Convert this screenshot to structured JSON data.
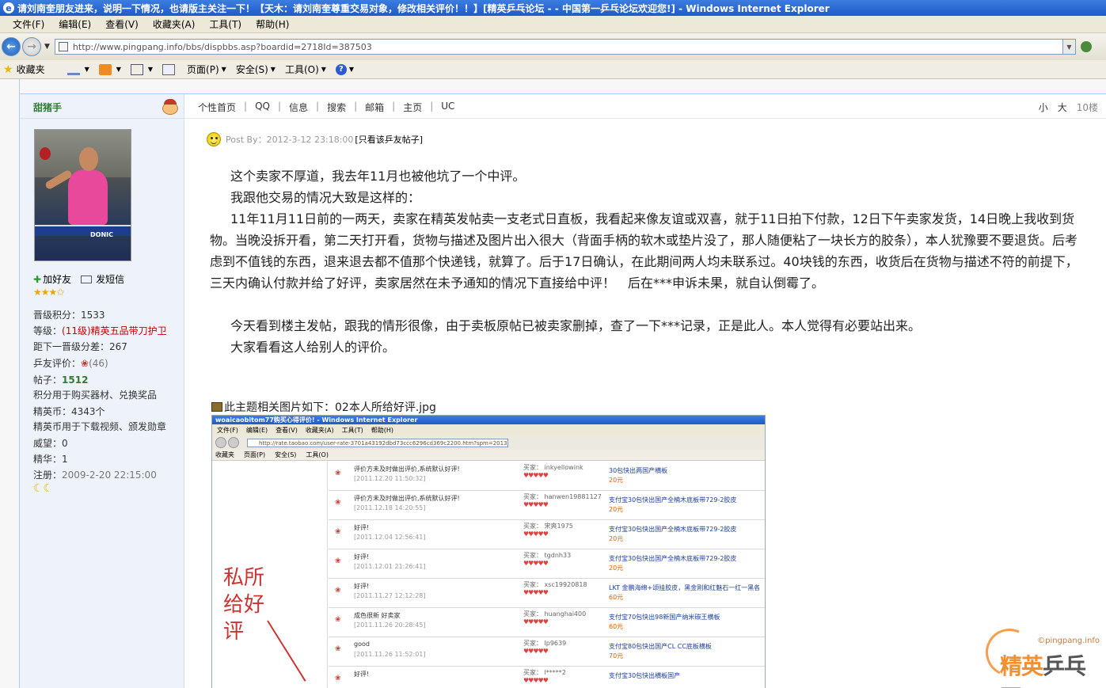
{
  "window": {
    "title": "请刘南奎朋友进来，说明一下情况，也请版主关注一下！【天木：请刘南奎尊重交易对象，修改相关评价！！】[精英乒乓论坛 - - 中国第一乒乓论坛欢迎您!] - Windows Internet Explorer",
    "icon": "e"
  },
  "menubar": [
    "文件(F)",
    "编辑(E)",
    "查看(V)",
    "收藏夹(A)",
    "工具(T)",
    "帮助(H)"
  ],
  "address": {
    "url": "http://www.pingpang.info/bbs/dispbbs.asp?boardid=2718Id=387503"
  },
  "commandbar": {
    "favorites": "收藏夹",
    "page": "页面(P)",
    "safety": "安全(S)",
    "tools": "工具(O)",
    "help": "?"
  },
  "user": {
    "name": "甜猪手",
    "add_friend": "加好友",
    "send_message": "发短信",
    "stars": "★★★✩",
    "level_points_label": "晋级积分：",
    "level_points": "1533",
    "grade_label": "等级：",
    "grade_value": "(11级)精英五品带刀护卫",
    "next_label": "距下一晋级分差：",
    "next_value": "267",
    "rating_label": "乒友评价：",
    "rating_value": "(46)",
    "posts_label": "帖子：",
    "posts_value": "1512",
    "points_note": "积分用于购买器材、兑换奖品",
    "coins_label": "精英币：",
    "coins_value": "4343个",
    "coins_note": "精英币用于下载视频、颁发勋章",
    "prestige_label": "威望：",
    "prestige_value": "0",
    "essence_label": "精华：",
    "essence_value": "1",
    "register_label": "注册：",
    "register_value": "2009-2-20 22:15:00"
  },
  "postnav": [
    "个性首页",
    "QQ",
    "信息",
    "搜索",
    "邮箱",
    "主页",
    "UC"
  ],
  "sizectl": {
    "small": "小",
    "large": "大",
    "floor": "10楼"
  },
  "post": {
    "by_label": "Post By：2012-3-12 23:18:00",
    "only_link": "[只看该乒友帖子]",
    "paragraphs": [
      "这个卖家不厚道，我去年11月也被他坑了一个中评。",
      "我跟他交易的情况大致是这样的：",
      "11年11月11日前的一两天，卖家在精英发帖卖一支老式日直板，我看起来像友谊或双喜，就于11日拍下付款，12日下午卖家发货，14日晚上我收到货物。当晚没拆开看，第二天打开看，货物与描述及图片出入很大（背面手柄的软木或垫片没了，那人随便粘了一块长方的胶条），本人犹豫要不要退货。后考虑到不值钱的东西，退来退去都不值那个快递钱，就算了。后于17日确认，在此期间两人均未联系过。40块钱的东西，收货后在货物与描述不符的前提下，三天内确认付款并给了好评，卖家居然在未予通知的情况下直接给中评！　后在***申诉未果，就自认倒霉了。",
      "今天看到楼主发帖，跟我的情形很像，由于卖板原帖已被卖家删掉，查了一下***记录，正是此人。本人觉得有必要站出来。",
      "大家看看这人给别人的评价。"
    ],
    "attachment": "此主题相关图片如下：02本人所给好评.jpg"
  },
  "screenshot": {
    "title": "woaicaobitom77购买心得评价! - Windows Internet Explorer",
    "menu": [
      "文件(F)",
      "编辑(E)",
      "查看(V)",
      "收藏夹(A)",
      "工具(T)",
      "帮助(H)"
    ],
    "url": "http://rate.taobao.com/user-rate-3701a43192dbd73ccc6296cd369c2200.htm?spm=2013.1.1000126.5",
    "cmd": [
      "收藏夹",
      "页面(P)",
      "安全(S)",
      "工具(O)"
    ],
    "handwriting": "私所给好评",
    "rows": [
      {
        "comment": "评价方未及时做出评价,系统默认好评!",
        "date": "[2011.12.20 11:50:32]",
        "buyer": "买家： inkyellowink",
        "item": "30包快出两国产横板",
        "price": "20元"
      },
      {
        "comment": "评价方未及时做出评价,系统默认好评!",
        "date": "[2011.12.18 14:20:55]",
        "buyer": "买家： hanwen19881127",
        "item": "支付宝30包快出国产全楠木底板带729-2胶皮",
        "price": "20元"
      },
      {
        "comment": "好评!",
        "date": "[2011.12.04 12:56:41]",
        "buyer": "买家： 宋爽1975",
        "item": "支付宝30包快出国产全楠木底板带729-2胶皮",
        "price": "20元"
      },
      {
        "comment": "好评!",
        "date": "[2011.12.01 21:26:41]",
        "buyer": "买家： tgdnh33",
        "item": "支付宝30包快出国产全楠木底板带729-2胶皮",
        "price": "20元"
      },
      {
        "comment": "好评!",
        "date": "[2011.11.27 12:12:28]",
        "buyer": "买家： xsc19920818",
        "item": "LKT 金鹏海绵+颂挂胶皮，黑金刚和红魅石一红一黑各...",
        "price": "60元"
      },
      {
        "comment": "成色很新 好卖家",
        "date": "[2011.11.26 20:28:45]",
        "buyer": "买家： huanghai400",
        "item": "支付宝70包快出98新国产纳米碳王横板",
        "price": "60元"
      },
      {
        "comment": "good",
        "date": "[2011.11.26 11:52:01]",
        "buyer": "买家： lp9639",
        "item": "支付宝80包快出国产CL CC底板横板",
        "price": "70元"
      },
      {
        "comment": "好评!",
        "date": "",
        "buyer": "买家： l*****2",
        "item": "支付宝30包快出横板国产",
        "price": ""
      }
    ]
  },
  "watermark": {
    "url": "©pingpang.info",
    "logo_a": "精英",
    "logo_b": "乒乓网"
  },
  "colors": {
    "titlebar": "#1f5bc7",
    "panel": "#eef3fb",
    "username": "#2e7d32",
    "grade": "#cc0000",
    "note": "#e06000"
  }
}
